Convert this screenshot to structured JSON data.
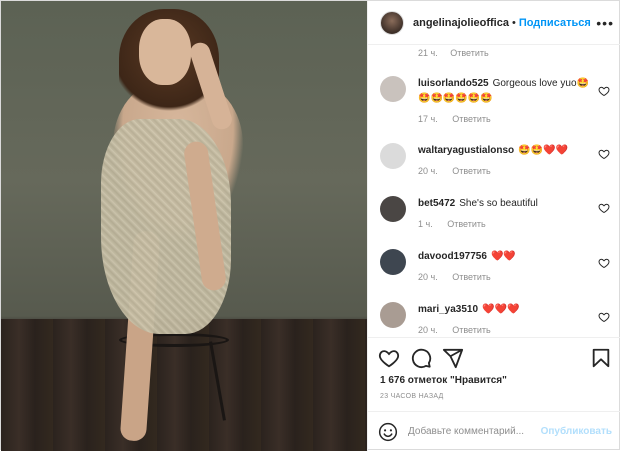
{
  "header": {
    "username": "angelinajolieoffica",
    "separator": "•",
    "follow_label": "Подписаться",
    "more_icon": "more-horizontal-icon"
  },
  "comments": {
    "top_meta": {
      "time": "21 ч.",
      "reply": "Ответить"
    },
    "items": [
      {
        "username": "luisorlando525",
        "text": "Gorgeous love yuo🤩🤩🤩🤩🤩🤩🤩",
        "time": "17 ч.",
        "reply": "Ответить",
        "avatar_color": "#c9c2bd"
      },
      {
        "username": "waltaryagustialonso",
        "text": "🤩🤩❤️❤️",
        "time": "20 ч.",
        "reply": "Ответить",
        "avatar_color": "#dbdbdb"
      },
      {
        "username": "bet5472",
        "text": "She's so beautiful",
        "time": "1 ч.",
        "reply": "Ответить",
        "avatar_color": "#4a4644"
      },
      {
        "username": "davood197756",
        "text": "❤️❤️",
        "time": "20 ч.",
        "reply": "Ответить",
        "avatar_color": "#3e4650"
      },
      {
        "username": "mari_ya3510",
        "text": "❤️❤️❤️",
        "time": "20 ч.",
        "reply": "Ответить",
        "avatar_color": "#a99c93"
      }
    ]
  },
  "actions": {
    "like_icon": "heart-icon",
    "comment_icon": "comment-icon",
    "share_icon": "paper-plane-icon",
    "save_icon": "bookmark-icon"
  },
  "likes_text": "1 676 отметок \"Нравится\"",
  "posted_text": "23 ЧАСОВ НАЗАД",
  "add_comment": {
    "placeholder": "Добавьте комментарий...",
    "publish_label": "Опубликовать",
    "emoji_icon": "emoji-icon"
  },
  "colors": {
    "link_blue": "#0095f6",
    "publish_disabled": "#b2dffc",
    "meta_gray": "#8e8e8e",
    "heart_red": "#ed4956"
  }
}
